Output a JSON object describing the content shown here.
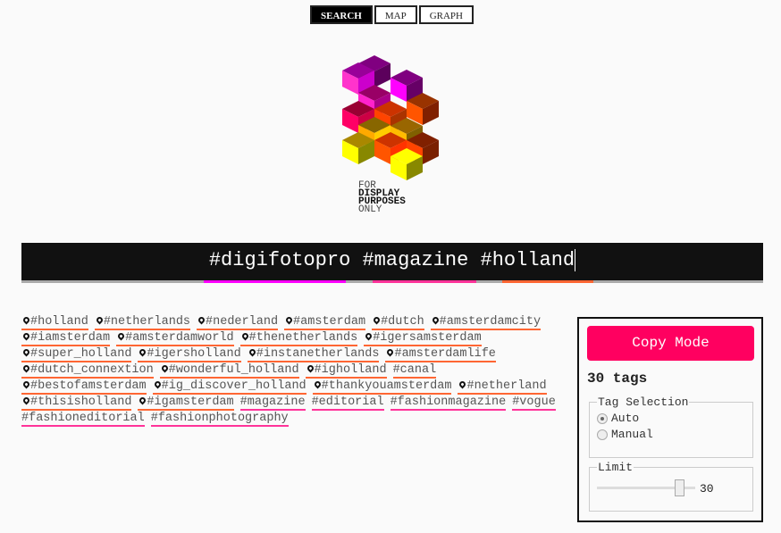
{
  "nav": {
    "items": [
      {
        "label": "SEARCH",
        "active": true
      },
      {
        "label": "MAP",
        "active": false
      },
      {
        "label": "GRAPH",
        "active": false
      }
    ]
  },
  "logo": {
    "text": [
      "FOR",
      "DISPLAY",
      "PURPOSES",
      "ONLY"
    ]
  },
  "search": {
    "words": [
      {
        "text": "#digifotopro",
        "color": "#ff00ff"
      },
      {
        "text": "#magazine",
        "color": "#ff3399"
      },
      {
        "text": "#holland",
        "color": "#ff6633"
      }
    ]
  },
  "tags": {
    "rows": [
      [
        {
          "t": "#holland",
          "loc": true
        },
        {
          "t": "#netherlands",
          "loc": true
        },
        {
          "t": "#nederland",
          "loc": true
        },
        {
          "t": "#amsterdam",
          "loc": true
        },
        {
          "t": "#dutch",
          "loc": true
        },
        {
          "t": "#amsterdamcity",
          "loc": true
        }
      ],
      [
        {
          "t": "#iamsterdam",
          "loc": true
        },
        {
          "t": "#amsterdamworld",
          "loc": true
        },
        {
          "t": "#thenetherlands",
          "loc": true
        },
        {
          "t": "#igersamsterdam",
          "loc": true
        }
      ],
      [
        {
          "t": "#super_holland",
          "loc": true
        },
        {
          "t": "#igersholland",
          "loc": true
        },
        {
          "t": "#instanetherlands",
          "loc": true
        },
        {
          "t": "#amsterdamlife",
          "loc": true
        }
      ],
      [
        {
          "t": "#dutch_connextion",
          "loc": true
        },
        {
          "t": "#wonderful_holland",
          "loc": true
        },
        {
          "t": "#igholland",
          "loc": true
        },
        {
          "t": "#canal",
          "loc": false,
          "color": "orange"
        }
      ],
      [
        {
          "t": "#bestofamsterdam",
          "loc": true
        },
        {
          "t": "#ig_discover_holland",
          "loc": true
        },
        {
          "t": "#thankyouamsterdam",
          "loc": true
        },
        {
          "t": "#netherland",
          "loc": true
        }
      ],
      [
        {
          "t": "#thisisholland",
          "loc": true
        },
        {
          "t": "#igamsterdam",
          "loc": true
        },
        {
          "t": "#magazine",
          "loc": false,
          "color": "pink"
        },
        {
          "t": "#editorial",
          "loc": false,
          "color": "pink"
        },
        {
          "t": "#fashionmagazine",
          "loc": false,
          "color": "pink"
        },
        {
          "t": "#vogue",
          "loc": false,
          "color": "pink"
        }
      ],
      [
        {
          "t": "#fashioneditorial",
          "loc": false,
          "color": "pink"
        },
        {
          "t": "#fashionphotography",
          "loc": false,
          "color": "pink"
        }
      ]
    ]
  },
  "panel": {
    "copy_label": "Copy Mode",
    "count": "30 tags",
    "selection_legend": "Tag Selection",
    "options": [
      {
        "label": "Auto",
        "checked": true
      },
      {
        "label": "Manual",
        "checked": false
      }
    ],
    "limit_legend": "Limit",
    "limit_value": "30",
    "limit_fraction": 0.85
  }
}
